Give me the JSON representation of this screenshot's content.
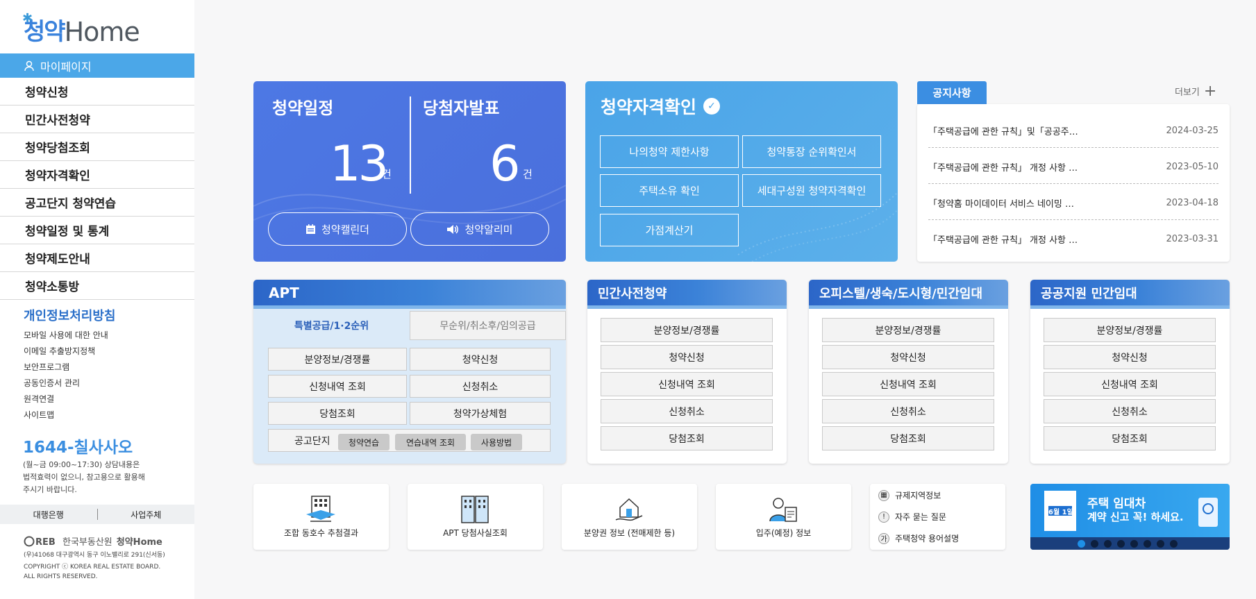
{
  "sidebar": {
    "logo_ko": "청약",
    "logo_en": "Home",
    "mypage": "마이페이지",
    "nav": [
      "청약신청",
      "민간사전청약",
      "청약당첨조회",
      "청약자격확인",
      "공고단지 청약연습",
      "청약일정 및 통계",
      "청약제도안내",
      "청약소통방"
    ],
    "privacy": "개인정보처리방침",
    "sublinks": [
      "모바일 사용에 대한 안내",
      "이메일 추출방지정책",
      "보안프로그램",
      "공동인증서 관리",
      "원격연결",
      "사이트맵"
    ],
    "phone": "1644-칠사사오",
    "hours": [
      "(월~금 09:00~17:30) 상담내용은",
      "법적효력이 없으니, 참고용으로 활용해",
      "주시기 바랍니다."
    ],
    "bottom_links": [
      "대행은행",
      "사업주체"
    ],
    "reb_label": "한국부동산원",
    "reb_brand": "청약Home",
    "address": [
      "(우)41068 대구광역시 동구 이노밸리로 291(신서동)",
      "COPYRIGHT ⓒ KOREA REAL ESTATE BOARD.",
      "ALL RIGHTS RESERVED."
    ]
  },
  "schedule": {
    "title": "청약일정",
    "count": "13",
    "unit": "건",
    "winners_title": "당첨자발표",
    "winners_count": "6",
    "winners_unit": "건",
    "calendar_btn": "청약캘린더",
    "alarm_btn": "청약알리미"
  },
  "qualification": {
    "title": "청약자격확인",
    "buttons": [
      "나의청약 제한사항",
      "청약통장 순위확인서",
      "주택소유 확인",
      "세대구성원 청약자격확인",
      "가점계산기"
    ]
  },
  "notice": {
    "tab": "공지사항",
    "more": "더보기",
    "items": [
      {
        "title": "「주택공급에 관한 규칙」및「공공주…",
        "date": "2024-03-25"
      },
      {
        "title": "「주택공급에 관한 규칙」 개정 사항 …",
        "date": "2023-05-10"
      },
      {
        "title": "「청약홈 마이데이터 서비스 네이밍 …",
        "date": "2023-04-18"
      },
      {
        "title": "「주택공급에 관한 규칙」 개정 사항 …",
        "date": "2023-03-31"
      }
    ]
  },
  "apt": {
    "title": "APT",
    "tabs": [
      "특별공급/1·2순위",
      "무순위/취소후/임의공급"
    ],
    "buttons": [
      "분양정보/경쟁률",
      "청약신청",
      "신청내역 조회",
      "신청취소",
      "당첨조회",
      "청약가상체험"
    ],
    "practice_label": "공고단지",
    "practice_buttons": [
      "청약연습",
      "연습내역 조회",
      "사용방법"
    ]
  },
  "panels": [
    {
      "title": "민간사전청약",
      "buttons": [
        "분양정보/경쟁률",
        "청약신청",
        "신청내역 조회",
        "신청취소",
        "당첨조회"
      ]
    },
    {
      "title": "오피스텔/생숙/도시형/민간임대",
      "buttons": [
        "분양정보/경쟁률",
        "청약신청",
        "신청내역 조회",
        "신청취소",
        "당첨조회"
      ]
    },
    {
      "title": "공공지원 민간임대",
      "buttons": [
        "분양정보/경쟁률",
        "청약신청",
        "신청내역 조회",
        "신청취소",
        "당첨조회"
      ]
    }
  ],
  "tiles": [
    "조합 동호수 추첨결과",
    "APT 당첨사실조회",
    "분양권 정보 (전매제한 등)",
    "입주(예정) 정보"
  ],
  "links": [
    "규제지역정보",
    "자주 묻는 질문",
    "주택청약 용어설명"
  ],
  "banner": {
    "line1": "주택 임대차",
    "line2": "계약 신고 꼭! 하세요.",
    "date": "6월 1일",
    "slides": 8,
    "active_slide": 1
  },
  "colors": {
    "accent": "#4ba7e8",
    "schedule_bg": "#4d78e4",
    "qual_bg": "#4aa4e8",
    "notice_tab": "#3b8ee2"
  }
}
